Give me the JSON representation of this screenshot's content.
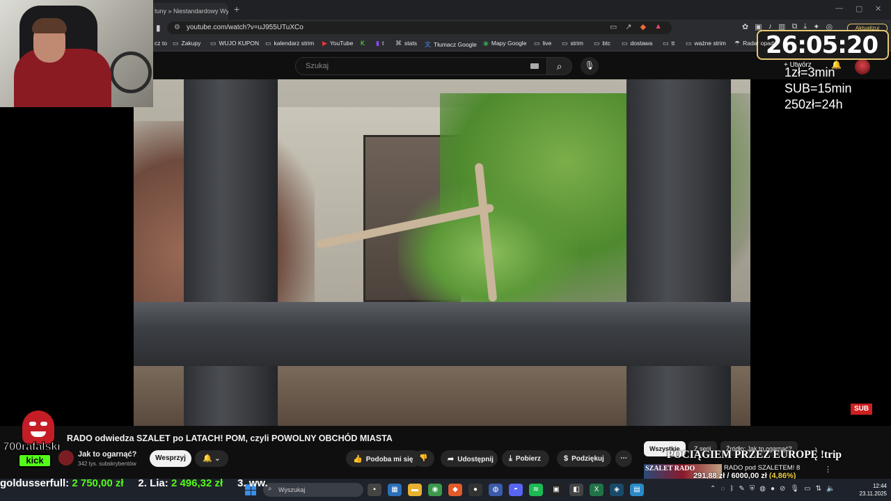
{
  "browser": {
    "tab_title": "tuny » Niestandardowy Wyb",
    "url": "youtube.com/watch?v=uJ955UTuXCo",
    "update_button": "Aktualizuj",
    "bookmarks": [
      {
        "label": "cz to",
        "icon": ""
      },
      {
        "label": "Zakupy",
        "icon": "folder-icon"
      },
      {
        "label": "WUJO KUPON",
        "icon": "folder-icon"
      },
      {
        "label": "kalendarz strim",
        "icon": "folder-icon"
      },
      {
        "label": "YouTube",
        "icon": "youtube-icon"
      },
      {
        "label": "",
        "icon": "kick-icon"
      },
      {
        "label": "t",
        "icon": "twitch-icon"
      },
      {
        "label": "stats",
        "icon": "link-icon"
      },
      {
        "label": "Tłumacz Google",
        "icon": "translate-icon"
      },
      {
        "label": "Mapy Google",
        "icon": "maps-icon"
      },
      {
        "label": "live",
        "icon": "folder-icon"
      },
      {
        "label": "strim",
        "icon": "folder-icon"
      },
      {
        "label": "btc",
        "icon": "folder-icon"
      },
      {
        "label": "dostawa",
        "icon": "folder-icon"
      },
      {
        "label": "tt",
        "icon": "folder-icon"
      },
      {
        "label": "ważne strim",
        "icon": "folder-icon"
      },
      {
        "label": "Radar opadó",
        "icon": "weather-icon"
      }
    ]
  },
  "youtube": {
    "search_placeholder": "Szukaj",
    "create_label": "+ Utwórz",
    "video_title": "RADO odwiedza SZALET po LATACH! POM, czyli POWOLNY OBCHÓD MIASTA",
    "channel_name": "Jak to ogarnąć?",
    "channel_subs": "342 tys. subskrybentów",
    "support_button": "Wesprzyj",
    "actions": {
      "like": "Podoba mi się",
      "share": "Udostępnij",
      "download": "Pobierz",
      "thanks": "Podziękuj"
    },
    "chips": [
      "Wszystkie",
      "Z serii",
      "Źródło: Jak to ogarnąć?"
    ],
    "suggestion_thumb_text": "SZALET RADO",
    "suggestion_title": "RADO pod SZALETEM! 8"
  },
  "overlay": {
    "timer": "26:05:20",
    "rates": [
      "1zł=3min",
      "SUB=15min",
      "250zł=24h"
    ],
    "sub_badge": "SUB",
    "travel_text": "POCIĄGIEM PRZEZ EUROPĘ !trip",
    "goal_current": "291,88 zł",
    "goal_sep": " / ",
    "goal_target": "6000,00 zł",
    "goal_pct": "(4,86%)",
    "logo_name": "700rafalski",
    "logo_platform": "kick",
    "ticker": [
      {
        "name": "goldusserfull:",
        "amount": "2 750,00 zł"
      },
      {
        "name": "2. Lia:",
        "amount": "2 496,32 zł"
      },
      {
        "name": "3. ww.",
        "amount": ""
      }
    ]
  },
  "taskbar": {
    "search_placeholder": "Wyszukaj",
    "time": "12:44",
    "date": "23.11.2025"
  }
}
